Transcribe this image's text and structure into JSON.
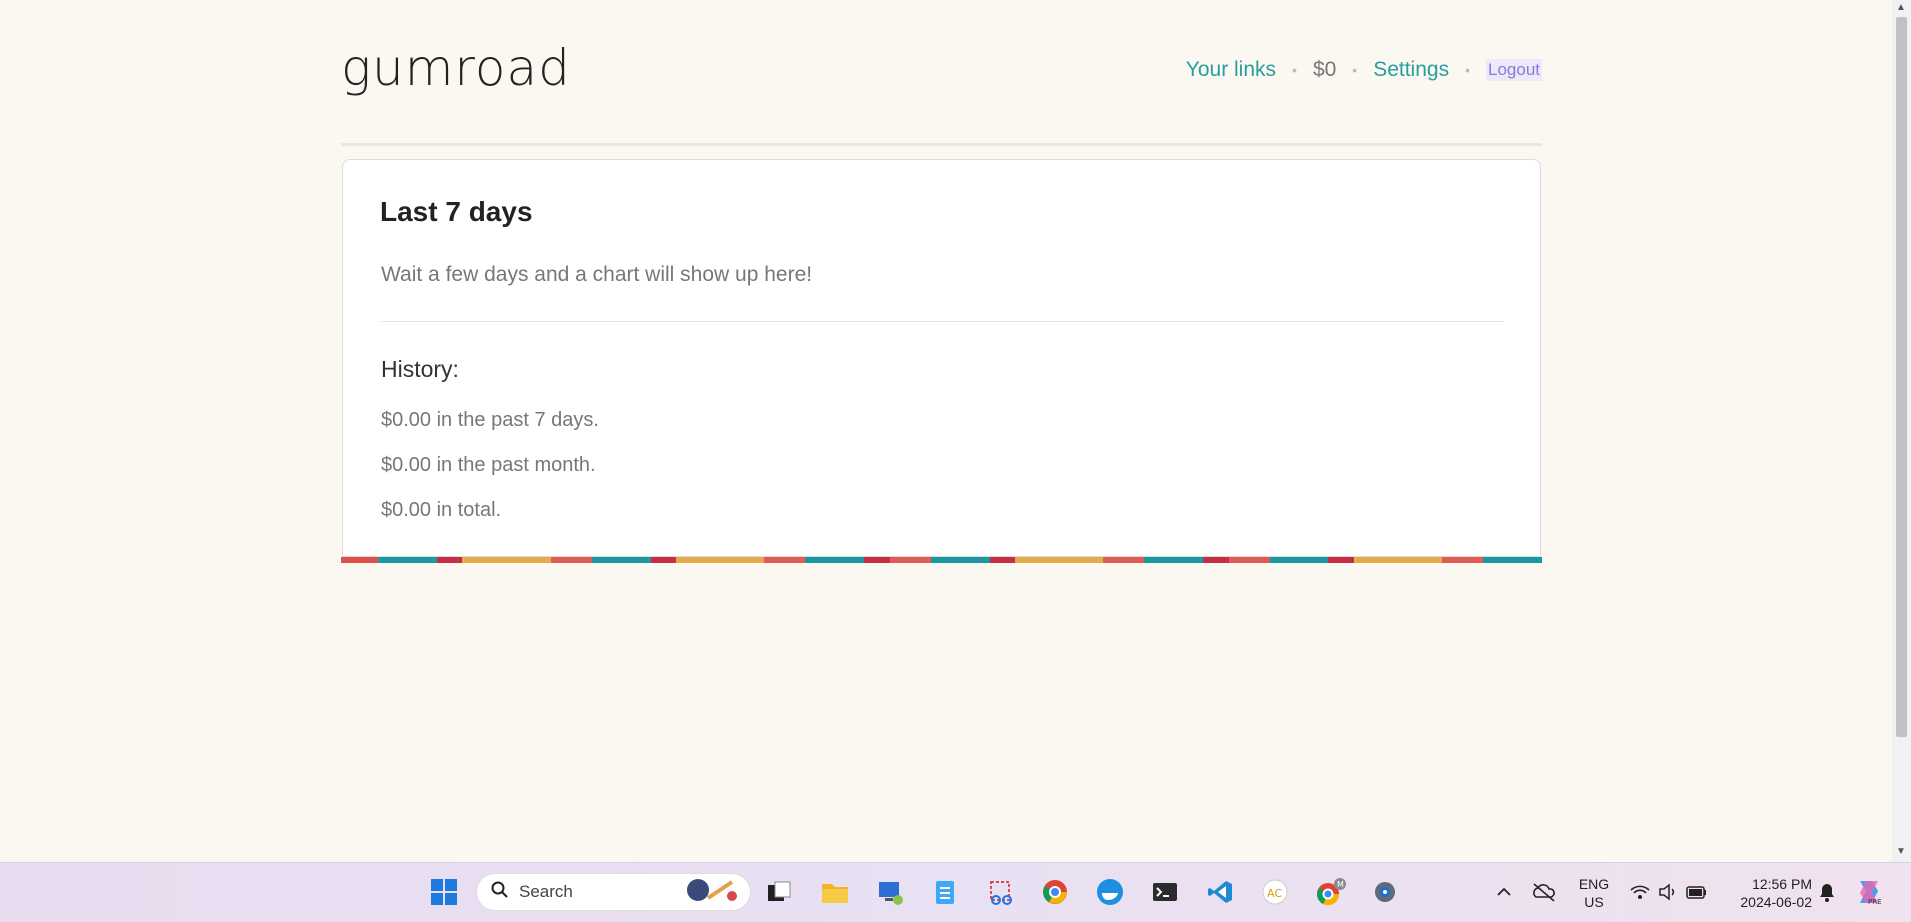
{
  "header": {
    "logo_text": "gumroad",
    "nav": {
      "your_links": "Your links",
      "balance": "$0",
      "settings": "Settings",
      "logout": "Logout",
      "separator": "•"
    }
  },
  "card": {
    "title": "Last 7 days",
    "empty_message": "Wait a few days and a chart will show up here!",
    "history_title": "History:",
    "history": [
      "$0.00 in the past 7 days.",
      "$0.00 in the past month.",
      "$0.00 in total."
    ]
  },
  "stripe_colors": [
    "#e0504a",
    "#1a9aa0",
    "#c72e44",
    "#e2ac4a",
    "#e15a54",
    "#1a9aa0",
    "#c72e44",
    "#e2ac4a",
    "#e15a54",
    "#1a9aa0",
    "#c72e44",
    "#e15a54",
    "#1a9aa0",
    "#c72e44",
    "#e2ac4a",
    "#e15a54",
    "#1a9aa0",
    "#c72e44",
    "#e15a54",
    "#1a9aa0",
    "#c72e44",
    "#e2ac4a",
    "#e15a54",
    "#1a9aa0"
  ],
  "taskbar": {
    "search_placeholder": "Search",
    "language": "ENG",
    "region": "US",
    "time": "12:56 PM",
    "date": "2024-06-02",
    "apps": [
      "windows-start-icon",
      "task-view-icon",
      "file-explorer-icon",
      "remote-desktop-icon",
      "notepad-icon",
      "snipping-tool-icon",
      "chrome-icon",
      "docker-icon",
      "terminal-icon",
      "vscode-icon",
      "acrobat-icon",
      "chrome-profile-icon",
      "settings-icon"
    ]
  },
  "colors": {
    "accent": "#2a9da0",
    "background": "#fbf8f1"
  }
}
